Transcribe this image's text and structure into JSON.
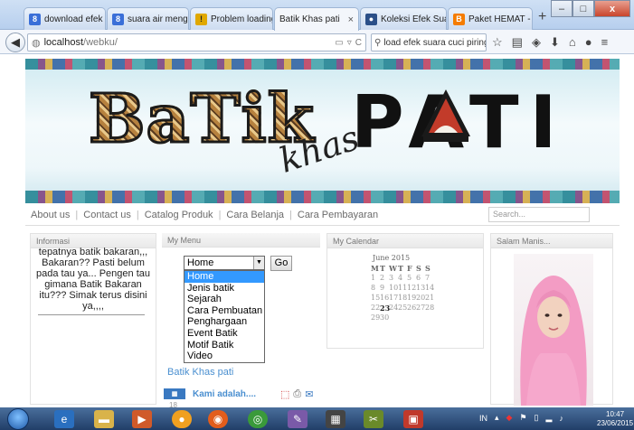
{
  "browser": {
    "tabs": [
      {
        "label": "download efek s...",
        "icon": "bookmark-icon",
        "color": "#3a6fd8"
      },
      {
        "label": "suara air mengal...",
        "icon": "bookmark-icon",
        "color": "#3a6fd8"
      },
      {
        "label": "Problem loading...",
        "icon": "warning-icon",
        "color": "#e0a800"
      },
      {
        "label": "Batik Khas pati",
        "icon": "page-icon",
        "color": "#777777"
      },
      {
        "label": "Koleksi Efek Suar...",
        "icon": "globe-icon",
        "color": "#2a4f88"
      },
      {
        "label": "Paket HEMAT - ...",
        "icon": "blogger-icon",
        "color": "#f57c00"
      }
    ],
    "active_tab_close": "×",
    "new_tab": "+",
    "url_host": "localhost",
    "url_path": "/webku/",
    "search_text": "load efek suara cuci piring"
  },
  "site": {
    "logo_batik": "BaTik",
    "logo_khas": "khas",
    "logo_pati": "PATI",
    "nav": [
      "About us",
      "Contact us",
      "Catalog Produk",
      "Cara Belanja",
      "Cara Pembayaran"
    ],
    "search_placeholder": "Search...",
    "info": {
      "title": "Informasi",
      "text": "tepatnya batik bakaran,,, Bakaran?? Pasti belum pada tau ya... Pengen tau gimana Batik Bakaran itu??? Simak terus disini ya,,,,"
    },
    "menu": {
      "title": "My Menu",
      "selected": "Home",
      "go": "Go",
      "options": [
        "Home",
        "Jenis batik",
        "Sejarah",
        "Cara Pembuatan",
        "Penghargaan",
        "Event Batik",
        "Motif Batik",
        "Video"
      ],
      "link": "Batik Khas pati",
      "article_title": "Kami adalah....",
      "article_num": "18"
    },
    "calendar": {
      "title": "My Calendar",
      "month": "June 2015",
      "days": [
        "M",
        "T",
        "W",
        "T",
        "F",
        "S",
        "S"
      ],
      "weeks": [
        [
          "1",
          "2",
          "3",
          "4",
          "5",
          "6",
          "7"
        ],
        [
          "8",
          "9",
          "10",
          "11",
          "12",
          "13",
          "14"
        ],
        [
          "15",
          "16",
          "17",
          "18",
          "19",
          "20",
          "21"
        ],
        [
          "22",
          "23",
          "24",
          "25",
          "26",
          "27",
          "28"
        ],
        [
          "29",
          "30",
          "",
          "",
          "",
          "",
          ""
        ]
      ],
      "today": "23"
    },
    "salam": {
      "title": "Salam Manis..."
    }
  },
  "taskbar": {
    "lang": "IN",
    "time": "10:47",
    "date": "23/06/2015"
  }
}
